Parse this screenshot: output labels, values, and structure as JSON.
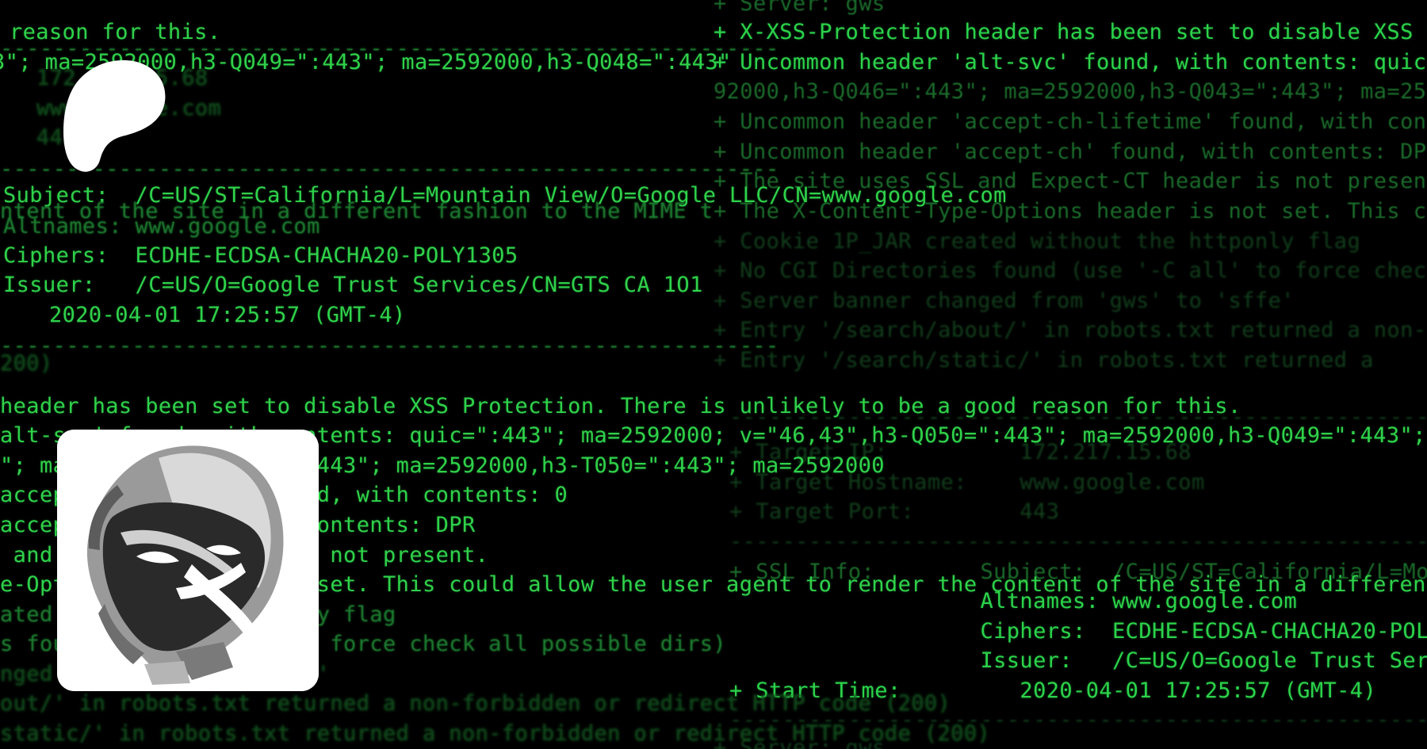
{
  "right_layer_lines": [
    "+ Server: gws",
    "+ X-XSS-Protection header has been set to disable XSS Prot",
    "+ Uncommon header 'alt-svc' found, with contents: quic=\":4",
    "92000,h3-Q046=\":443\"; ma=2592000,h3-Q043=\":443\"; ma=259200",
    "+ Uncommon header 'accept-ch-lifetime' found, with conten",
    "+ Uncommon header 'accept-ch' found, with contents: DPR",
    "+ The site uses SSL and Expect-CT header is not present.",
    "+ The X-Content-Type-Options header is not set. This coul",
    "+ Cookie 1P_JAR created without the httponly flag",
    "+ No CGI Directories found (use '-C all' to force check al",
    "+ Server banner changed from 'gws' to 'sffe'",
    "+ Entry '/search/about/' in robots.txt returned a non-forb",
    "+ Entry '/search/static/' in robots.txt returned a",
    "------------------------------------------------------------",
    "+ Target IP:          172.217.15.68",
    "+ Target Hostname:    www.google.com",
    "+ Target Port:        443",
    "------------------------------------------------------------",
    "+ SSL Info:        Subject:  /C=US/ST=California/L=Mountai",
    "                   Altnames: www.google.com",
    "                   Ciphers:  ECDHE-ECDSA-CHACHA20-POLY1305",
    "                   Issuer:   /C=US/O=Google Trust Service",
    "+ Start Time:         2020-04-01 17:25:57 (GMT-4)",
    "------------------------------------------------------------",
    "+ Server: gws"
  ],
  "left_layer_lines": [
    "reason for this.",
    "-----------------------------------------------------------",
    "3\"; ma=2592000,h3-Q049=\":443\"; ma=2592000,h3-Q048=\":443\"",
    "172.217.15.68",
    "www.google.com",
    "443",
    "-----------------------------------------------------------",
    "Subject:  /C=US/ST=California/L=Mountain View/O=Google LLC/CN=www.google.com",
    "ntent of the site in a different fashion to the MIME t",
    "Altnames: www.google.com",
    "Ciphers:  ECDHE-ECDSA-CHACHA20-POLY1305",
    "Issuer:   /C=US/O=Google Trust Services/CN=GTS CA 1O1",
    "   2020-04-01 17:25:57 (GMT-4)",
    "-----------------------------------------------------------",
    "200)",
    "header has been set to disable XSS Protection. There is unlikely to be a good reason for this.",
    "alt-svc' found, with contents: quic=\":443\"; ma=2592000; v=\"46,43\",h3-Q050=\":443\"; ma=2592000,h3-Q049=\":443\"; ma=2592",
    "\"; ma=2592000,h3-Q043=\":443\"; ma=2592000,h3-T050=\":443\"; ma=2592000",
    "accept-ch-lifetime' found, with contents: 0",
    "accept-ch' found, with contents: DPR",
    " and Expect-CT header is not present.",
    "e-Options header is not set. This could allow the user agent to render the content of the site in a different fashion",
    "ated without the httponly flag",
    "s found (use '-C all' to force check all possible dirs)",
    "nged from 'gws' to 'sffe'",
    "out/' in robots.txt returned a non-forbidden or redirect HTTP code (200)",
    "static/' in robots.txt returned a non-forbidden or redirect HTTP code (200)"
  ],
  "logo_icon": "patreon-logo-icon",
  "avatar_icon": "masked-hacker-avatar-icon",
  "colors": {
    "background": "#000000",
    "terminal_green": "#2fd24a",
    "terminal_green_dim": "#1a6b2a",
    "card_white": "#ffffff"
  }
}
